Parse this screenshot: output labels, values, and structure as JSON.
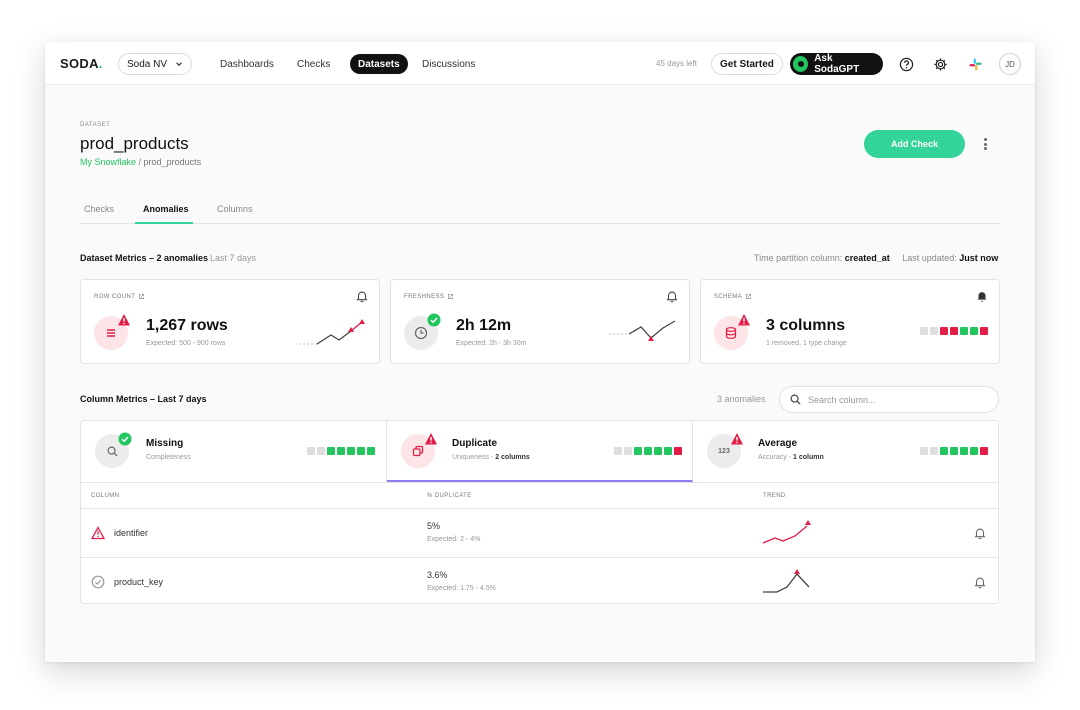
{
  "nav": {
    "logo": "SODA",
    "logo_dot": ".",
    "org": "Soda NV",
    "links": [
      "Dashboards",
      "Checks",
      "Datasets",
      "Discussions"
    ],
    "active_link": "Datasets",
    "trial": "45 days left",
    "get_started": "Get Started",
    "ask_gpt": "Ask SodaGPT",
    "avatar": "JD"
  },
  "header": {
    "eyebrow": "DATASET",
    "title": "prod_products",
    "breadcrumb_source": "My Snowflake",
    "breadcrumb_sep": " / ",
    "breadcrumb_dataset": "prod_products",
    "add_check": "Add Check"
  },
  "tabs": [
    "Checks",
    "Anomalies",
    "Columns"
  ],
  "active_tab": "Anomalies",
  "dataset_metrics": {
    "title": "Dataset Metrics – 2 anomalies",
    "period": "Last 7 days",
    "partition_label": "Time partition column: ",
    "partition_value": "created_at",
    "updated_label": "Last updated: ",
    "updated_value": "Just now",
    "cards": [
      {
        "label": "ROW COUNT",
        "value": "1,267 rows",
        "sub": "Expected: 500 - 900 rows",
        "status": "anomaly",
        "icon": "list-icon"
      },
      {
        "label": "FRESHNESS",
        "value": "2h 12m",
        "sub": "Expected: 2h - 3h 30m",
        "status": "ok",
        "icon": "clock-icon"
      },
      {
        "label": "SCHEMA",
        "value": "3 columns",
        "sub": "1 removed, 1 type change",
        "status": "anomaly",
        "icon": "database-icon"
      }
    ]
  },
  "column_metrics": {
    "title": "Column Metrics – Last 7 days",
    "anomaly_count": "3 anomalies",
    "search_placeholder": "Search column...",
    "tabs": [
      {
        "title": "Missing",
        "sub": "Completeness",
        "sub_bold": "",
        "status": "ok"
      },
      {
        "title": "Duplicate",
        "sub": "Uniqueness - ",
        "sub_bold": "2 columns",
        "status": "anomaly"
      },
      {
        "title": "Average",
        "sub": "Accuracy - ",
        "sub_bold": "1 column",
        "status": "anomaly",
        "icon_text": "123"
      }
    ],
    "table": {
      "headers": [
        "COLUMN",
        "% DUPLICATE",
        "TREND"
      ],
      "rows": [
        {
          "column": "identifier",
          "value": "5%",
          "expected": "Expected: 2 - 4%",
          "status": "anomaly"
        },
        {
          "column": "product_key",
          "value": "3.6%",
          "expected": "Expected: 1.75 - 4.5%",
          "status": "ok"
        }
      ]
    }
  },
  "colors": {
    "accent": "#34d399",
    "anomaly": "#e11d48",
    "ok": "#22c55e",
    "selected_tab": "#8b7cf0"
  }
}
